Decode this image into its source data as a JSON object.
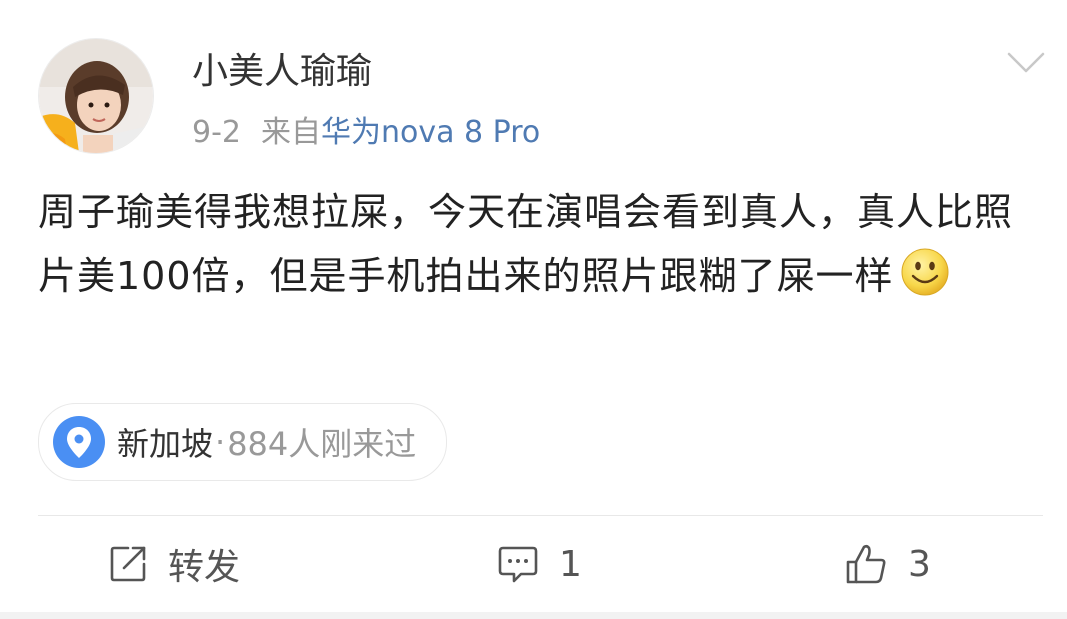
{
  "post": {
    "author": {
      "name": "小美人瑜瑜",
      "avatar_icon": "user-avatar"
    },
    "meta": {
      "date": "9-2",
      "source_prefix": "来自",
      "device": "华为nova 8 Pro"
    },
    "menu_icon": "chevron-down-icon",
    "content": {
      "text": "周子瑜美得我想拉屎，今天在演唱会看到真人，真人比照片美100倍，但是手机拍出来的照片跟糊了屎一样",
      "emoji_icon": "smiley-emoji"
    },
    "location": {
      "icon": "location-pin-icon",
      "name": "新加坡",
      "separator": "·",
      "visitors": "884人刚来过"
    },
    "actions": {
      "repost_label": "转发",
      "comment_count": "1",
      "like_count": "3"
    }
  },
  "colors": {
    "link_blue": "#4f7ab2",
    "pin_blue": "#4a8ff3",
    "text_primary": "#222222",
    "text_secondary": "#999999",
    "smiley_yellow": "#f8d74a"
  }
}
